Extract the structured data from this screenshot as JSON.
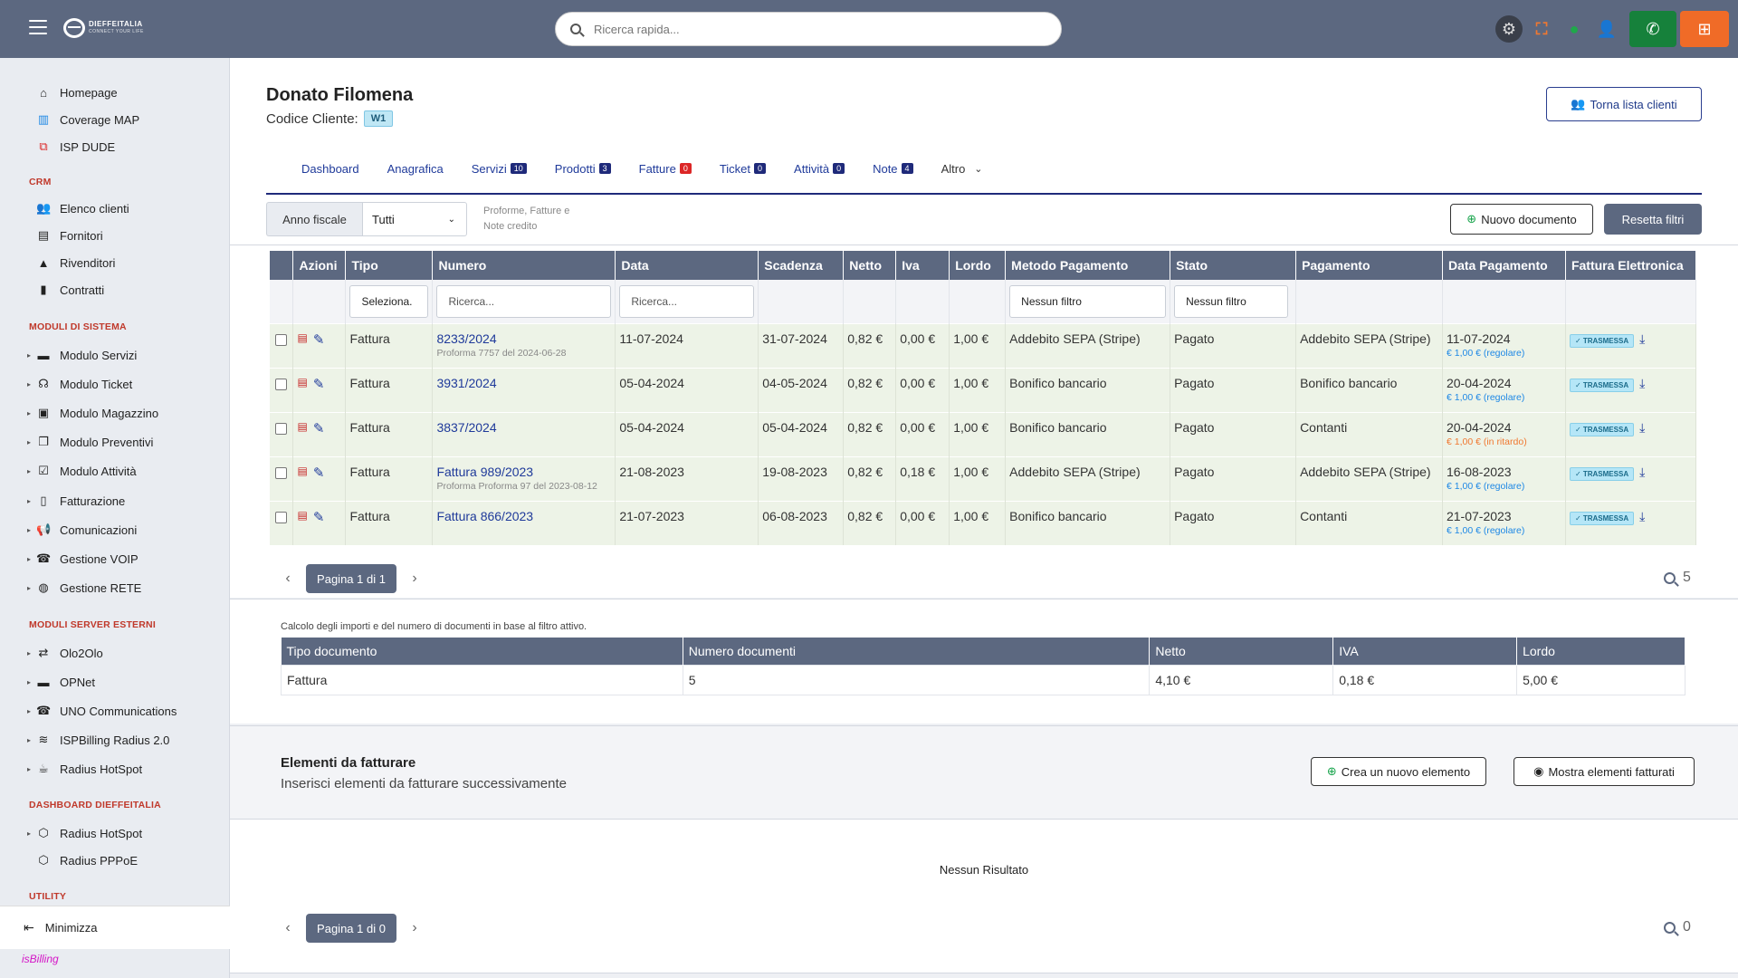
{
  "topbar": {
    "logo": {
      "name": "DIEFFEITALIA",
      "tagline": "CONNECT YOUR LIFE"
    },
    "search_placeholder": "Ricerca rapida..."
  },
  "sidebar": {
    "items_top": [
      {
        "label": "Homepage",
        "icon": "home-icon"
      },
      {
        "label": "Coverage MAP",
        "icon": "map-icon"
      },
      {
        "label": "ISP DUDE",
        "icon": "network-icon"
      }
    ],
    "crm": {
      "title": "CRM",
      "items": [
        {
          "label": "Elenco clienti",
          "icon": "users-icon"
        },
        {
          "label": "Fornitori",
          "icon": "store-icon"
        },
        {
          "label": "Rivenditori",
          "icon": "user-tie-icon"
        },
        {
          "label": "Contratti",
          "icon": "file-icon"
        }
      ]
    },
    "moduli": {
      "title": "MODULI DI SISTEMA",
      "items": [
        {
          "label": "Modulo Servizi",
          "icon": "server-icon"
        },
        {
          "label": "Modulo Ticket",
          "icon": "headset-icon"
        },
        {
          "label": "Modulo Magazzino",
          "icon": "warehouse-icon"
        },
        {
          "label": "Modulo Preventivi",
          "icon": "copy-icon"
        },
        {
          "label": "Modulo Attività",
          "icon": "tasks-icon"
        },
        {
          "label": "Fatturazione",
          "icon": "invoice-icon"
        },
        {
          "label": "Comunicazioni",
          "icon": "megaphone-icon"
        },
        {
          "label": "Gestione VOIP",
          "icon": "phone-icon"
        },
        {
          "label": "Gestione RETE",
          "icon": "globe-icon"
        }
      ]
    },
    "esterni": {
      "title": "MODULI SERVER ESTERNI",
      "items": [
        {
          "label": "Olo2Olo",
          "icon": "exchange-icon"
        },
        {
          "label": "OPNet",
          "icon": "server-icon"
        },
        {
          "label": "UNO Communications",
          "icon": "phone-icon"
        },
        {
          "label": "ISPBilling Radius 2.0",
          "icon": "wifi-icon"
        },
        {
          "label": "Radius HotSpot",
          "icon": "coffee-icon"
        }
      ]
    },
    "dashboard": {
      "title": "DASHBOARD DIEFFEITALIA",
      "items": [
        {
          "label": "Radius HotSpot",
          "icon": "cube-icon"
        },
        {
          "label": "Radius PPPoE",
          "icon": "cube-icon"
        }
      ]
    },
    "utility_title": "UTILITY",
    "minimize_label": "Minimizza",
    "brand": "isBilling"
  },
  "client": {
    "name": "Donato Filomena",
    "code_label": "Codice Cliente:",
    "code": "W1",
    "back_button": "Torna lista clienti"
  },
  "tabs": [
    {
      "label": "Dashboard",
      "count": null
    },
    {
      "label": "Anagrafica",
      "count": null
    },
    {
      "label": "Servizi",
      "count": "10"
    },
    {
      "label": "Prodotti",
      "count": "3"
    },
    {
      "label": "Fatture",
      "count": "0"
    },
    {
      "label": "Ticket",
      "count": "0"
    },
    {
      "label": "Attività",
      "count": "0"
    },
    {
      "label": "Note",
      "count": "4"
    },
    {
      "label": "Altro",
      "count": null
    }
  ],
  "filters": {
    "anno_label": "Anno fiscale",
    "anno_value": "Tutti",
    "hint": "Proforme, Fatture e Note credito",
    "new_doc": "Nuovo documento",
    "reset": "Resetta filtri"
  },
  "docs_table": {
    "headers": [
      "Azioni",
      "Tipo",
      "Numero",
      "Data",
      "Scadenza",
      "Netto",
      "Iva",
      "Lordo",
      "Metodo Pagamento",
      "Stato",
      "Pagamento",
      "Data Pagamento",
      "Fattura Elettronica"
    ],
    "filter_placeholders": {
      "tipo": "Seleziona.",
      "numero": "Ricerca...",
      "data": "Ricerca...",
      "metodo": "Nessun filtro",
      "stato": "Nessun filtro"
    },
    "rows": [
      {
        "tipo": "Fattura",
        "numero": "8233/2024",
        "numero_sub": "Proforma 7757 del 2024-06-28",
        "data": "11-07-2024",
        "scadenza": "31-07-2024",
        "netto": "0,82 €",
        "iva": "0,00 €",
        "lordo": "1,00 €",
        "metodo": "Addebito SEPA (Stripe)",
        "stato": "Pagato",
        "pagamento": "Addebito SEPA (Stripe)",
        "data_pag": "11-07-2024",
        "data_pag_sub": "€ 1,00 € (regolare)",
        "sub_type": "ok",
        "fe": "✓ TRASMESSA"
      },
      {
        "tipo": "Fattura",
        "numero": "3931/2024",
        "numero_sub": "",
        "data": "05-04-2024",
        "scadenza": "04-05-2024",
        "netto": "0,82 €",
        "iva": "0,00 €",
        "lordo": "1,00 €",
        "metodo": "Bonifico bancario",
        "stato": "Pagato",
        "pagamento": "Bonifico bancario",
        "data_pag": "20-04-2024",
        "data_pag_sub": "€ 1,00 € (regolare)",
        "sub_type": "ok",
        "fe": "✓ TRASMESSA"
      },
      {
        "tipo": "Fattura",
        "numero": "3837/2024",
        "numero_sub": "",
        "data": "05-04-2024",
        "scadenza": "05-04-2024",
        "netto": "0,82 €",
        "iva": "0,00 €",
        "lordo": "1,00 €",
        "metodo": "Bonifico bancario",
        "stato": "Pagato",
        "pagamento": "Contanti",
        "data_pag": "20-04-2024",
        "data_pag_sub": "€ 1,00 € (in ritardo)",
        "sub_type": "late",
        "fe": "✓ TRASMESSA"
      },
      {
        "tipo": "Fattura",
        "numero": "Fattura 989/2023",
        "numero_sub": "Proforma Proforma 97 del 2023-08-12",
        "data": "21-08-2023",
        "scadenza": "19-08-2023",
        "netto": "0,82 €",
        "iva": "0,18 €",
        "lordo": "1,00 €",
        "metodo": "Addebito SEPA (Stripe)",
        "stato": "Pagato",
        "pagamento": "Addebito SEPA (Stripe)",
        "data_pag": "16-08-2023",
        "data_pag_sub": "€ 1,00 € (regolare)",
        "sub_type": "ok",
        "fe": "✓ TRASMESSA"
      },
      {
        "tipo": "Fattura",
        "numero": "Fattura 866/2023",
        "numero_sub": "",
        "data": "21-07-2023",
        "scadenza": "06-08-2023",
        "netto": "0,82 €",
        "iva": "0,00 €",
        "lordo": "1,00 €",
        "metodo": "Bonifico bancario",
        "stato": "Pagato",
        "pagamento": "Contanti",
        "data_pag": "21-07-2023",
        "data_pag_sub": "€ 1,00 € (regolare)",
        "sub_type": "ok",
        "fe": "✓ TRASMESSA"
      }
    ],
    "pager": "Pagina 1 di 1",
    "count": "5"
  },
  "summary": {
    "note": "Calcolo degli importi e del numero di documenti in base al filtro attivo.",
    "headers": [
      "Tipo documento",
      "Numero documenti",
      "Netto",
      "IVA",
      "Lordo"
    ],
    "row": [
      "Fattura",
      "5",
      "4,10 €",
      "0,18 €",
      "5,00 €"
    ]
  },
  "elements": {
    "title": "Elementi da fatturare",
    "subtitle": "Inserisci elementi da fatturare successivamente",
    "create_button": "Crea un nuovo elemento",
    "show_button": "Mostra elementi fatturati",
    "empty": "Nessun Risultato",
    "pager": "Pagina 1 di 0",
    "count": "0"
  }
}
